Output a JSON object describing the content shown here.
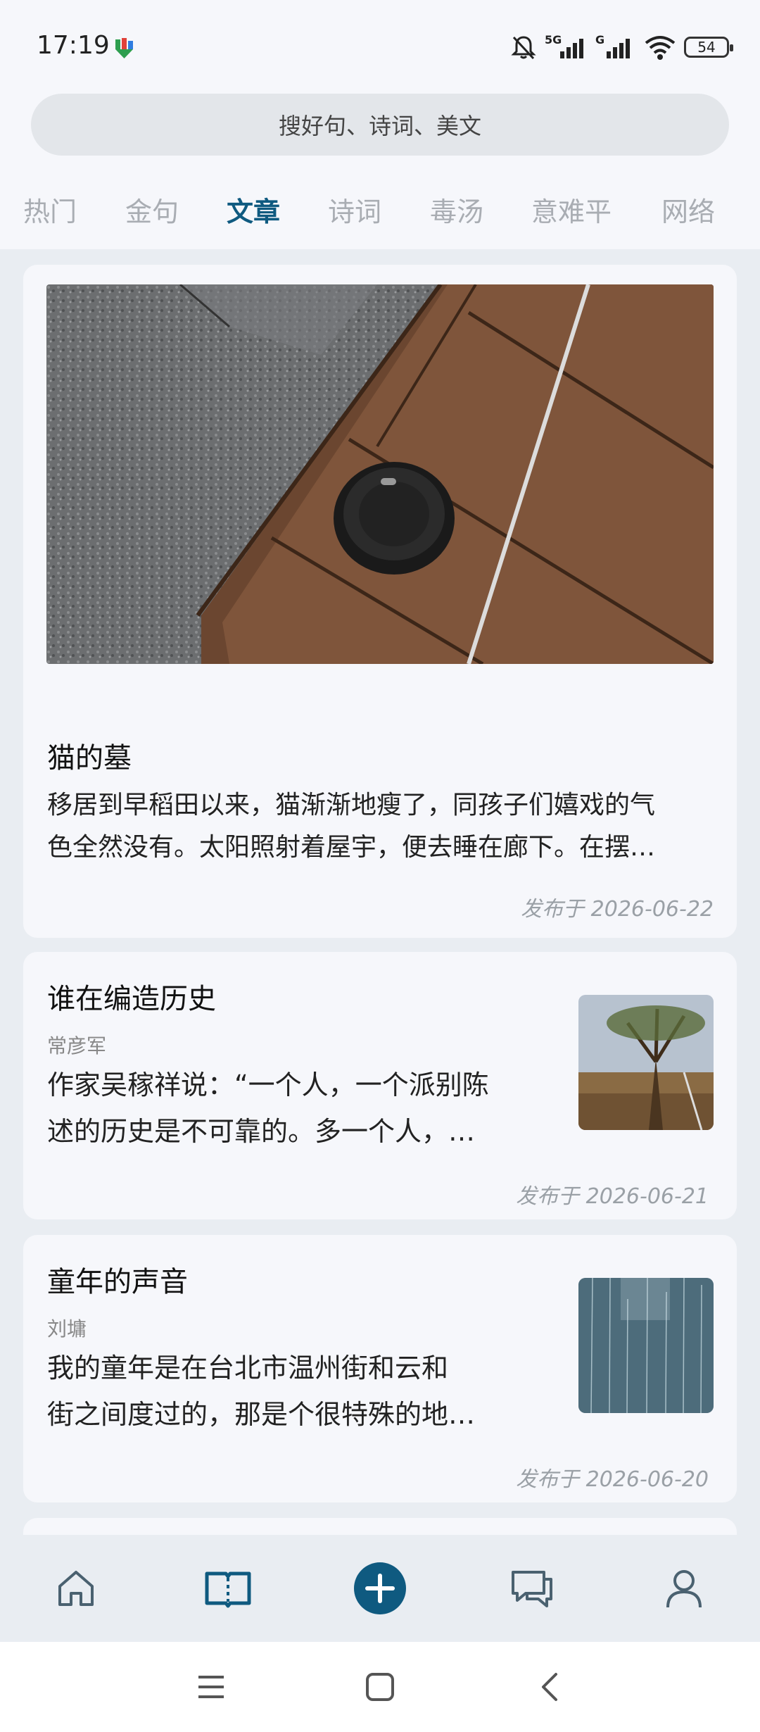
{
  "status": {
    "time": "17:19",
    "battery": "54",
    "signal1_label": "5G",
    "signal2_label": "G"
  },
  "search": {
    "placeholder": "搜好句、诗词、美文"
  },
  "tabs": [
    {
      "label": "热门"
    },
    {
      "label": "金句"
    },
    {
      "label": "文章",
      "active": true
    },
    {
      "label": "诗词"
    },
    {
      "label": "毒汤"
    },
    {
      "label": "意难平"
    },
    {
      "label": "网络"
    }
  ],
  "articles": [
    {
      "title": "猫的墓",
      "body_line1": "移居到早稻田以来，猫渐渐地瘦了，同孩子们嬉戏的气",
      "body_line2": "色全然没有。太阳照射着屋宇，便去睡在廊下。在摆…",
      "date": "发布于 2026-06-22"
    },
    {
      "title": "谁在编造历史",
      "author": "常彦军",
      "body_line1": "作家吴稼祥说：“一个人，一个派别陈",
      "body_line2": "述的历史是不可靠的。多一个人，…",
      "date": "发布于 2026-06-21"
    },
    {
      "title": "童年的声音",
      "author": "刘墉",
      "body_line1": "我的童年是在台北市温州街和云和",
      "body_line2": "街之间度过的，那是个很特殊的地…",
      "date": "发布于 2026-06-20"
    }
  ],
  "nav": [
    {
      "icon": "home-icon"
    },
    {
      "icon": "book-icon",
      "active": true
    },
    {
      "icon": "add-icon"
    },
    {
      "icon": "chat-icon"
    },
    {
      "icon": "profile-icon"
    }
  ],
  "colors": {
    "accent": "#0f5a80",
    "tab_inactive": "#a9adb3",
    "background": "#e9edf2",
    "card": "#f6f7fb"
  }
}
